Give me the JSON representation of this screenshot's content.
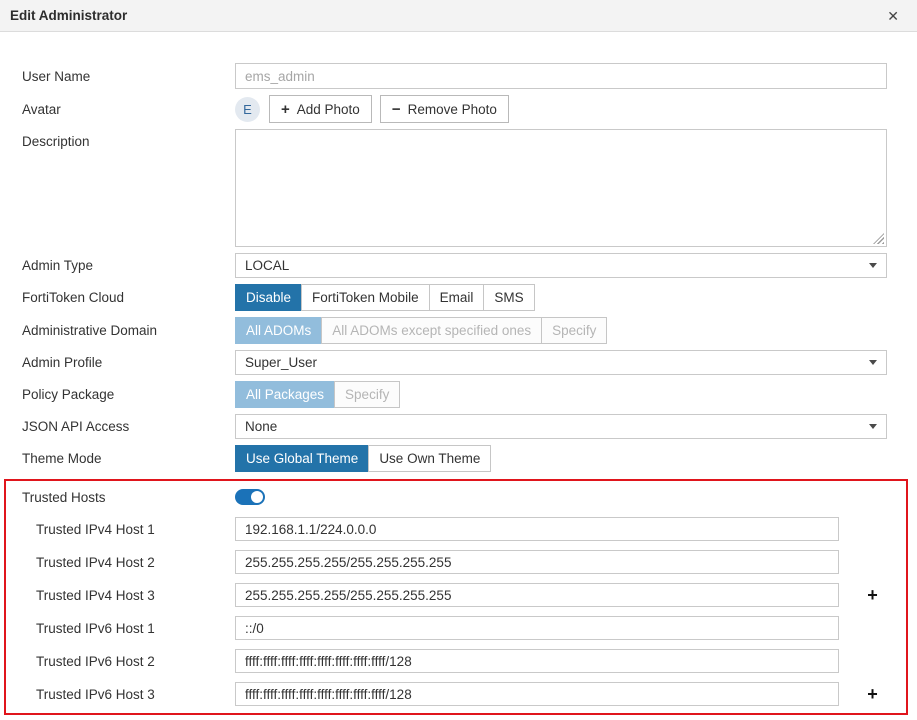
{
  "colors": {
    "accent_blue": "#2373a9",
    "muted_selected_blue": "#92bddc",
    "highlight_red": "#e0151c"
  },
  "dialog": {
    "title": "Edit Administrator",
    "close_icon": "✕"
  },
  "form": {
    "user_name": {
      "label": "User Name",
      "value": "ems_admin"
    },
    "avatar": {
      "label": "Avatar",
      "initial": "E",
      "plus_icon": "+",
      "minus_icon": "−",
      "add_photo_label": "Add Photo",
      "remove_photo_label": "Remove Photo"
    },
    "description": {
      "label": "Description",
      "value": ""
    },
    "admin_type": {
      "label": "Admin Type",
      "value": "LOCAL"
    },
    "fortitoken_cloud": {
      "label": "FortiToken Cloud",
      "options": [
        "Disable",
        "FortiToken Mobile",
        "Email",
        "SMS"
      ],
      "selected": "Disable"
    },
    "administrative_domain": {
      "label": "Administrative Domain",
      "options": [
        "All ADOMs",
        "All ADOMs except specified ones",
        "Specify"
      ],
      "selected": "All ADOMs",
      "disabled": true
    },
    "admin_profile": {
      "label": "Admin Profile",
      "value": "Super_User"
    },
    "policy_package": {
      "label": "Policy Package",
      "options": [
        "All Packages",
        "Specify"
      ],
      "selected": "All Packages",
      "disabled": true
    },
    "json_api_access": {
      "label": "JSON API Access",
      "value": "None"
    },
    "theme_mode": {
      "label": "Theme Mode",
      "options": [
        "Use Global Theme",
        "Use Own Theme"
      ],
      "selected": "Use Global Theme"
    },
    "trusted_hosts": {
      "label": "Trusted Hosts",
      "enabled": true,
      "add_icon": "+",
      "rows": [
        {
          "label": "Trusted IPv4 Host 1",
          "value": "192.168.1.1/224.0.0.0"
        },
        {
          "label": "Trusted IPv4 Host 2",
          "value": "255.255.255.255/255.255.255.255"
        },
        {
          "label": "Trusted IPv4 Host 3",
          "value": "255.255.255.255/255.255.255.255"
        },
        {
          "label": "Trusted IPv6 Host 1",
          "value": "::/0"
        },
        {
          "label": "Trusted IPv6 Host 2",
          "value": "ffff:ffff:ffff:ffff:ffff:ffff:ffff:ffff/128"
        },
        {
          "label": "Trusted IPv6 Host 3",
          "value": "ffff:ffff:ffff:ffff:ffff:ffff:ffff:ffff/128"
        }
      ]
    }
  }
}
